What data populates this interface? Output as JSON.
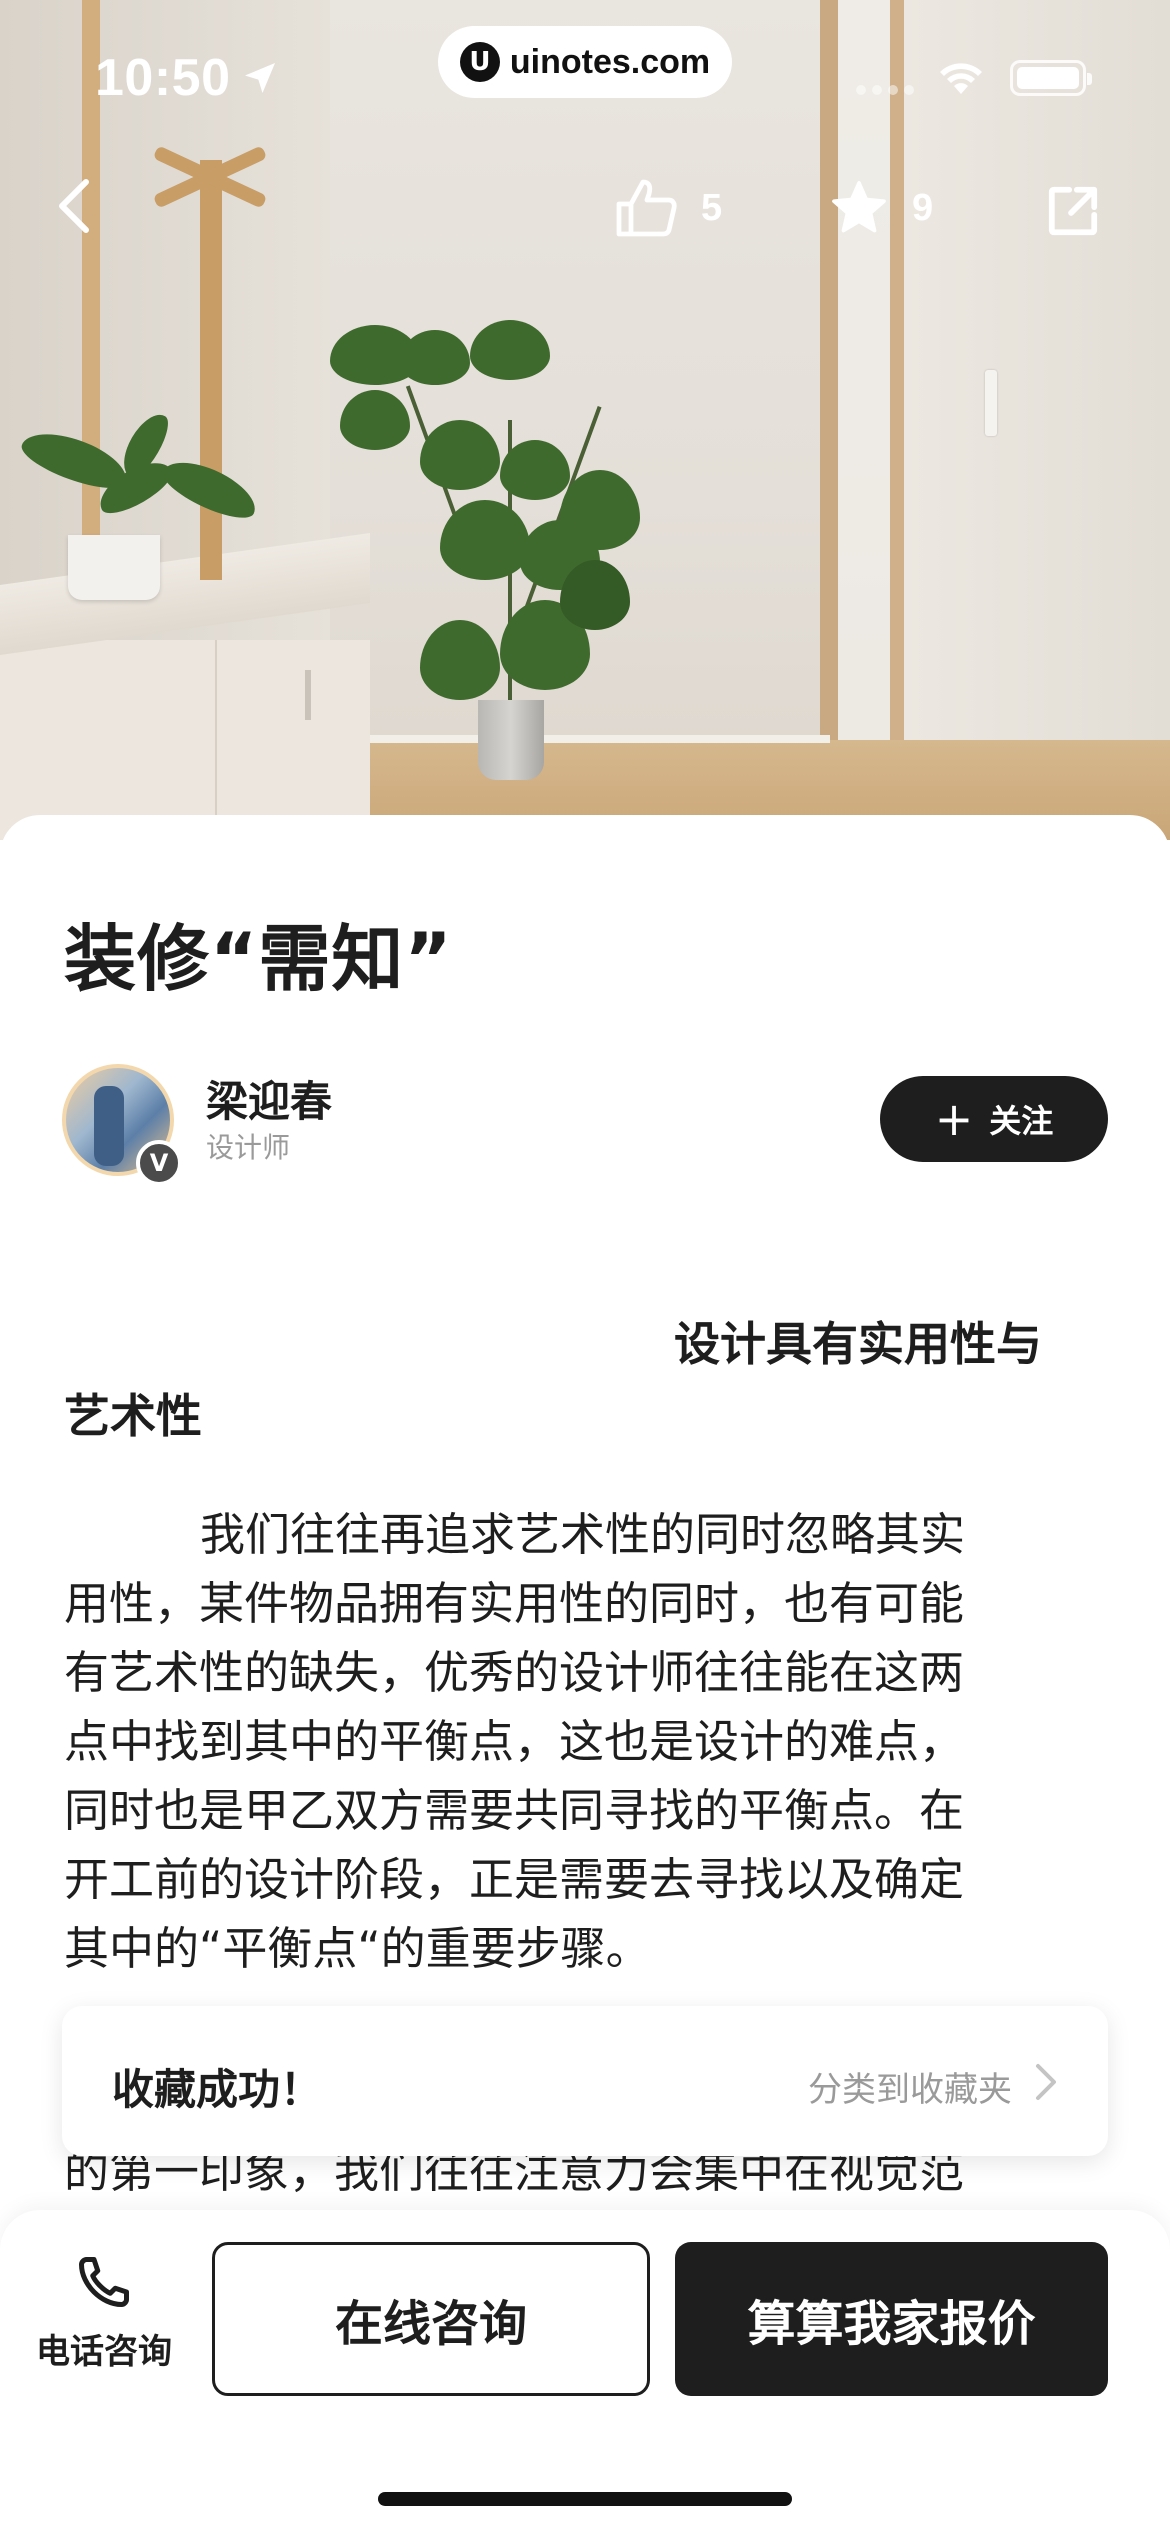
{
  "status_bar": {
    "time": "10:50",
    "url": "uinotes.com",
    "url_badge": "U"
  },
  "nav": {
    "like_count": "5",
    "favorite_count": "9"
  },
  "article": {
    "title": "装修“需知”",
    "author": {
      "name": "梁迎春",
      "role": "设计师",
      "badge": "V"
    },
    "follow_label": "关注",
    "follow_plus": "+",
    "subheading_line1": "设计具有实用性与",
    "subheading_line2": "艺术性",
    "paragraph_lines": [
      "我们往往再追求艺术性的同时忽略其实",
      "用性，某件物品拥有实用性的同时，也有可能",
      "有艺术性的缺失，优秀的设计师往往能在这两",
      "点中找到其中的平衡点，这也是设计的难点，",
      "同时也是甲乙双方需要共同寻找的平衡点。在",
      "开工前的设计阶段，正是需要去寻找以及确定",
      "其中的“平衡点“的重要步骤。"
    ],
    "partial_line": "的第一印象，我们往往注意力会集中在视觉范"
  },
  "toast": {
    "message": "收藏成功！",
    "action": "分类到收藏夹"
  },
  "bottom_bar": {
    "phone_label": "电话咨询",
    "consult_label": "在线咨询",
    "quote_label": "算算我家报价"
  },
  "colors": {
    "primary_dark": "#1e1e1e",
    "secondary_text": "#9a9a9a",
    "background": "#ffffff"
  }
}
